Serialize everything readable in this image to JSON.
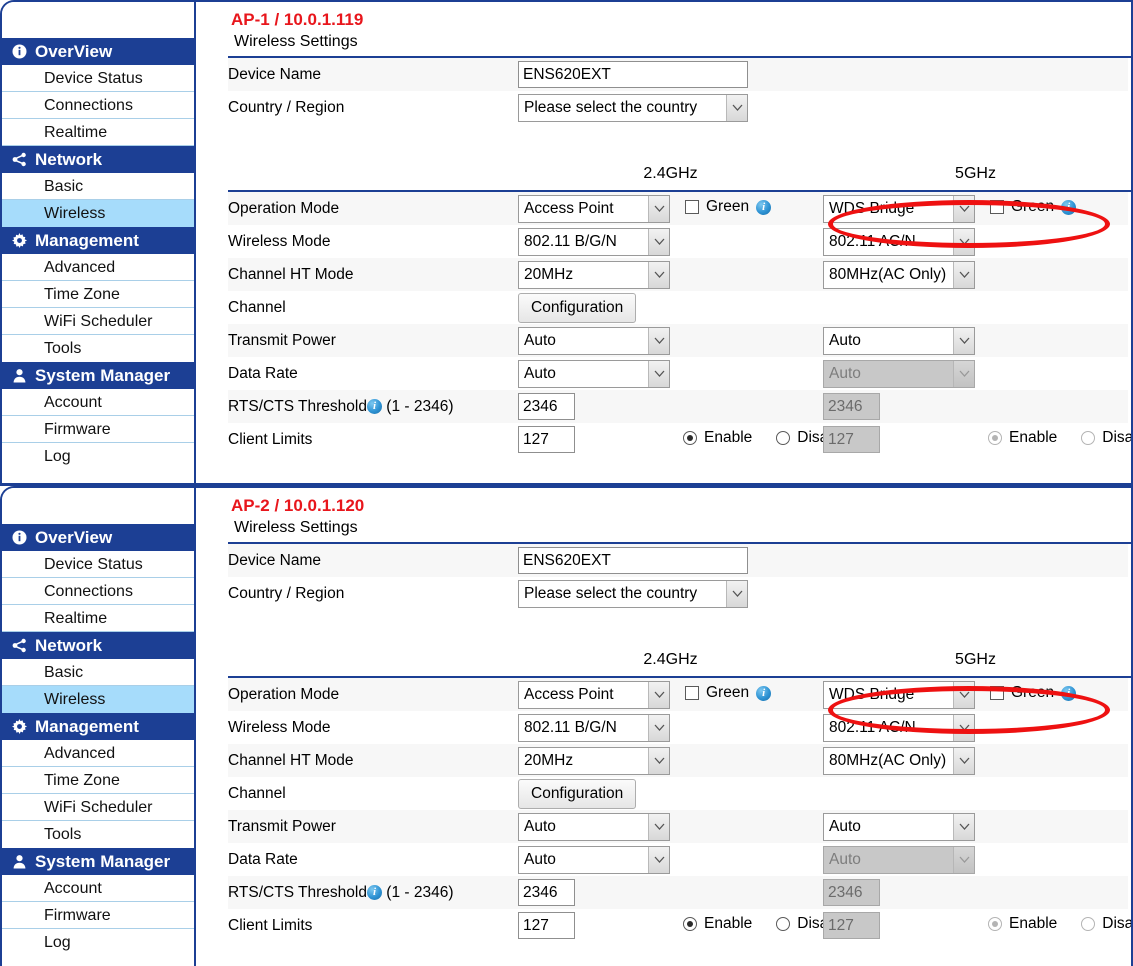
{
  "sidebar": {
    "groups": [
      {
        "label": "OverView",
        "icon": "info-icon",
        "items": [
          {
            "label": "Device Status",
            "active": false
          },
          {
            "label": "Connections",
            "active": false
          },
          {
            "label": "Realtime",
            "active": false
          }
        ]
      },
      {
        "label": "Network",
        "icon": "share-icon",
        "items": [
          {
            "label": "Basic",
            "active": false
          },
          {
            "label": "Wireless",
            "active": true
          }
        ]
      },
      {
        "label": "Management",
        "icon": "gear-icon",
        "items": [
          {
            "label": "Advanced",
            "active": false
          },
          {
            "label": "Time Zone",
            "active": false
          },
          {
            "label": "WiFi Scheduler",
            "active": false
          },
          {
            "label": "Tools",
            "active": false
          }
        ]
      },
      {
        "label": "System Manager",
        "icon": "user-icon",
        "items": [
          {
            "label": "Account",
            "active": false
          },
          {
            "label": "Firmware",
            "active": false
          },
          {
            "label": "Log",
            "active": false
          }
        ]
      }
    ]
  },
  "colors": {
    "header_blue": "#1c3f94",
    "active_item": "#a6dcfb",
    "title_red": "#e8161c",
    "annotation_red": "#ee1111"
  },
  "panels": [
    {
      "ap_title": "AP-1 / 10.0.1.119",
      "section_title": "Wireless Settings",
      "device_name_label": "Device Name",
      "device_name_value": "ENS620EXT",
      "country_label": "Country / Region",
      "country_value": "Please select the country",
      "band_2g": "2.4GHz",
      "band_5g": "5GHz",
      "rows": [
        {
          "label": "Operation Mode",
          "v24": "Access Point",
          "v5": "WDS Bridge",
          "green_label": "Green",
          "green_checked_24": false,
          "green_checked_5": false
        },
        {
          "label": "Wireless Mode",
          "v24": "802.11 B/G/N",
          "v5": "802.11 AC/N"
        },
        {
          "label": "Channel HT Mode",
          "v24": "20MHz",
          "v5": "80MHz(AC Only)"
        },
        {
          "label": "Channel",
          "button": "Configuration"
        },
        {
          "label": "Transmit Power",
          "v24": "Auto",
          "v5": "Auto"
        },
        {
          "label": "Data Rate",
          "v24": "Auto",
          "v5": "Auto",
          "v5_disabled": true
        },
        {
          "label": "RTS/CTS Threshold",
          "label_suffix": "(1 - 2346)",
          "v24": "2346",
          "v5": "2346",
          "v5_disabled": true
        },
        {
          "label": "Client Limits",
          "v24": "127",
          "v5": "127",
          "v5_disabled": true,
          "enable_label": "Enable",
          "disable_label": "Disable",
          "enable_selected_24": true,
          "enable_selected_5": true
        }
      ]
    },
    {
      "ap_title": "AP-2 / 10.0.1.120",
      "section_title": "Wireless Settings",
      "device_name_label": "Device Name",
      "device_name_value": "ENS620EXT",
      "country_label": "Country / Region",
      "country_value": "Please select the country",
      "band_2g": "2.4GHz",
      "band_5g": "5GHz",
      "rows": [
        {
          "label": "Operation Mode",
          "v24": "Access Point",
          "v5": "WDS Bridge",
          "green_label": "Green",
          "green_checked_24": false,
          "green_checked_5": false
        },
        {
          "label": "Wireless Mode",
          "v24": "802.11 B/G/N",
          "v5": "802.11 AC/N"
        },
        {
          "label": "Channel HT Mode",
          "v24": "20MHz",
          "v5": "80MHz(AC Only)"
        },
        {
          "label": "Channel",
          "button": "Configuration"
        },
        {
          "label": "Transmit Power",
          "v24": "Auto",
          "v5": "Auto"
        },
        {
          "label": "Data Rate",
          "v24": "Auto",
          "v5": "Auto",
          "v5_disabled": true
        },
        {
          "label": "RTS/CTS Threshold",
          "label_suffix": "(1 - 2346)",
          "v24": "2346",
          "v5": "2346",
          "v5_disabled": true
        },
        {
          "label": "Client Limits",
          "v24": "127",
          "v5": "127",
          "v5_disabled": true,
          "enable_label": "Enable",
          "disable_label": "Disable",
          "enable_selected_24": true,
          "enable_selected_5": true
        }
      ]
    }
  ]
}
